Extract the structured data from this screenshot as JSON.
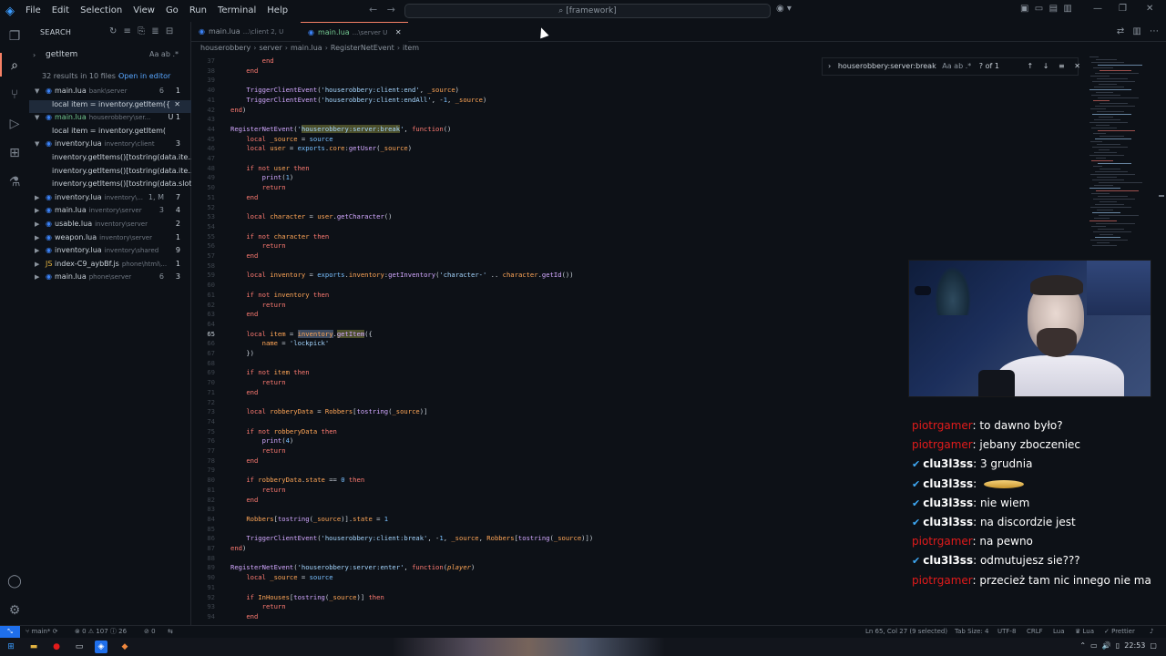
{
  "menu": [
    "File",
    "Edit",
    "Selection",
    "View",
    "Go",
    "Run",
    "Terminal",
    "Help"
  ],
  "command_center": "[framework]",
  "sidebar": {
    "title": "SEARCH",
    "query": "getItem",
    "toggles": "Aa ab .*",
    "summary": "32 results in 10 files - ",
    "open_in_editor": "Open in editor",
    "files": [
      {
        "name": "main.lua",
        "path": "bank\\server",
        "count": "6",
        "badge": "1",
        "expanded": true,
        "git": false,
        "matches": [
          {
            "text": "local item = inventory.getItem({",
            "selected": true
          }
        ]
      },
      {
        "name": "main.lua",
        "path": "houserobbery\\ser...",
        "count": "",
        "badge": "U  1",
        "expanded": true,
        "git": true,
        "matches": [
          {
            "text": "local item = inventory.getItem(",
            "selected": false
          }
        ]
      },
      {
        "name": "inventory.lua",
        "path": "inventory\\client",
        "count": "",
        "badge": "3",
        "expanded": true,
        "git": false,
        "matches": [
          {
            "text": "inventory.getItems()[tostring(data.ite...",
            "selected": false
          },
          {
            "text": "inventory.getItems()[tostring(data.ite...",
            "selected": false
          },
          {
            "text": "inventory.getItems()[tostring(data.slot...",
            "selected": false
          }
        ]
      },
      {
        "name": "inventory.lua",
        "path": "inventory\\...",
        "count": "1, M",
        "badge": "7",
        "expanded": false,
        "git": false,
        "matches": []
      },
      {
        "name": "main.lua",
        "path": "inventory\\server",
        "count": "3",
        "badge": "4",
        "expanded": false,
        "git": false,
        "matches": []
      },
      {
        "name": "usable.lua",
        "path": "inventory\\server",
        "count": "",
        "badge": "2",
        "expanded": false,
        "git": false,
        "matches": []
      },
      {
        "name": "weapon.lua",
        "path": "inventory\\server",
        "count": "",
        "badge": "1",
        "expanded": false,
        "git": false,
        "matches": []
      },
      {
        "name": "inventory.lua",
        "path": "inventory\\shared",
        "count": "",
        "badge": "9",
        "expanded": false,
        "git": false,
        "matches": []
      },
      {
        "name": "index-C9_aybBf.js",
        "path": "phone\\html\\...",
        "count": "",
        "badge": "1",
        "expanded": false,
        "git": false,
        "matches": []
      },
      {
        "name": "main.lua",
        "path": "phone\\server",
        "count": "6",
        "badge": "3",
        "expanded": false,
        "git": false,
        "matches": []
      }
    ]
  },
  "tabs": [
    {
      "label": "main.lua",
      "desc": "...\\client 2, U",
      "active": false
    },
    {
      "label": "main.lua",
      "desc": "...\\server U",
      "active": true
    }
  ],
  "breadcrumb": [
    "houserobbery",
    "server",
    "main.lua",
    "RegisterNetEvent",
    "item"
  ],
  "find_widget": {
    "query": "houserobbery:server:break",
    "toggles": "Aa ab .*",
    "count": "? of 1"
  },
  "code_lines": [
    {
      "n": "37",
      "html": "<span class=\"kw\">        end</span>"
    },
    {
      "n": "38",
      "html": "<span class=\"kw\">    end</span>"
    },
    {
      "n": "39",
      "html": ""
    },
    {
      "n": "40",
      "html": "    <span class=\"fn\">TriggerClientEvent</span>(<span class=\"str\">'houserobbery:client:end'</span>, <span class=\"var\">_source</span>)"
    },
    {
      "n": "41",
      "html": "    <span class=\"fn\">TriggerClientEvent</span>(<span class=\"str\">'houserobbery:client:endAll'</span>, -<span class=\"sym\">1</span>, <span class=\"var\">_source</span>)"
    },
    {
      "n": "42",
      "html": "<span class=\"kw\">end</span>)"
    },
    {
      "n": "43",
      "html": ""
    },
    {
      "n": "44",
      "html": "<span class=\"fn\">RegisterNetEvent</span>(<span class=\"str\">'<span class=\"hlw\">houserobbery:server:break</span>'</span>, <span class=\"kw\">function</span>()"
    },
    {
      "n": "45",
      "html": "    <span class=\"kw\">local</span> <span class=\"var\">_source</span> = <span class=\"sym\">source</span>"
    },
    {
      "n": "46",
      "html": "    <span class=\"kw\">local</span> <span class=\"var\">user</span> = <span class=\"sym\">exports</span>.<span class=\"var\">core</span>:<span class=\"fn\">getUser</span>(<span class=\"var\">_source</span>)"
    },
    {
      "n": "47",
      "html": ""
    },
    {
      "n": "48",
      "html": "    <span class=\"kw\">if not</span> <span class=\"var\">user</span> <span class=\"kw\">then</span>"
    },
    {
      "n": "49",
      "html": "        <span class=\"fn\">print</span>(<span class=\"sym\">1</span>)"
    },
    {
      "n": "50",
      "html": "        <span class=\"kw\">return</span>"
    },
    {
      "n": "51",
      "html": "    <span class=\"kw\">end</span>"
    },
    {
      "n": "52",
      "html": ""
    },
    {
      "n": "53",
      "html": "    <span class=\"kw\">local</span> <span class=\"var\">character</span> = <span class=\"var\">user</span>.<span class=\"fn\">getCharacter</span>()"
    },
    {
      "n": "54",
      "html": ""
    },
    {
      "n": "55",
      "html": "    <span class=\"kw\">if not</span> <span class=\"var\">character</span> <span class=\"kw\">then</span>"
    },
    {
      "n": "56",
      "html": "        <span class=\"kw\">return</span>"
    },
    {
      "n": "57",
      "html": "    <span class=\"kw\">end</span>"
    },
    {
      "n": "58",
      "html": ""
    },
    {
      "n": "59",
      "html": "    <span class=\"kw\">local</span> <span class=\"var\">inventory</span> = <span class=\"sym\">exports</span>.<span class=\"var\">inventory</span>:<span class=\"fn\">getInventory</span>(<span class=\"str\">'character-'</span> .. <span class=\"var\">character</span>.<span class=\"fn\">getId</span>())"
    },
    {
      "n": "60",
      "html": ""
    },
    {
      "n": "61",
      "html": "    <span class=\"kw\">if not</span> <span class=\"var\">inventory</span> <span class=\"kw\">then</span>"
    },
    {
      "n": "62",
      "html": "        <span class=\"kw\">return</span>"
    },
    {
      "n": "63",
      "html": "    <span class=\"kw\">end</span>"
    },
    {
      "n": "64",
      "html": ""
    },
    {
      "n": "65",
      "html": "    <span class=\"kw\">local</span> <span class=\"var\">item</span> = <span class=\"var sel\">inventory</span>.<span class=\"fn hlw\">getItem</span>({",
      "cur": true
    },
    {
      "n": "66",
      "html": "        <span class=\"var\">name</span> = <span class=\"str\">'lockpick'</span>"
    },
    {
      "n": "67",
      "html": "    })"
    },
    {
      "n": "68",
      "html": ""
    },
    {
      "n": "69",
      "html": "    <span class=\"kw\">if not</span> <span class=\"var\">item</span> <span class=\"kw\">then</span>"
    },
    {
      "n": "70",
      "html": "        <span class=\"kw\">return</span>"
    },
    {
      "n": "71",
      "html": "    <span class=\"kw\">end</span>"
    },
    {
      "n": "72",
      "html": ""
    },
    {
      "n": "73",
      "html": "    <span class=\"kw\">local</span> <span class=\"var\">robberyData</span> = <span class=\"var\">Robbers</span>[<span class=\"fn\">tostring</span>(<span class=\"var\">_source</span>)]"
    },
    {
      "n": "74",
      "html": ""
    },
    {
      "n": "75",
      "html": "    <span class=\"kw\">if not</span> <span class=\"var\">robberyData</span> <span class=\"kw\">then</span>"
    },
    {
      "n": "76",
      "html": "        <span class=\"fn\">print</span>(<span class=\"sym\">4</span>)"
    },
    {
      "n": "77",
      "html": "        <span class=\"kw\">return</span>"
    },
    {
      "n": "78",
      "html": "    <span class=\"kw\">end</span>"
    },
    {
      "n": "79",
      "html": ""
    },
    {
      "n": "80",
      "html": "    <span class=\"kw\">if</span> <span class=\"var\">robberyData</span>.<span class=\"var\">state</span> == <span class=\"sym\">0</span> <span class=\"kw\">then</span>"
    },
    {
      "n": "81",
      "html": "        <span class=\"kw\">return</span>"
    },
    {
      "n": "82",
      "html": "    <span class=\"kw\">end</span>"
    },
    {
      "n": "83",
      "html": ""
    },
    {
      "n": "84",
      "html": "    <span class=\"var\">Robbers</span>[<span class=\"fn\">tostring</span>(<span class=\"var\">_source</span>)].<span class=\"var\">state</span> = <span class=\"sym\">1</span>"
    },
    {
      "n": "85",
      "html": ""
    },
    {
      "n": "86",
      "html": "    <span class=\"fn\">TriggerClientEvent</span>(<span class=\"str\">'houserobbery:client:break'</span>, -<span class=\"sym\">1</span>, <span class=\"var\">_source</span>, <span class=\"var\">Robbers</span>[<span class=\"fn\">tostring</span>(<span class=\"var\">_source</span>)])"
    },
    {
      "n": "87",
      "html": "<span class=\"kw\">end</span>)"
    },
    {
      "n": "88",
      "html": ""
    },
    {
      "n": "89",
      "html": "<span class=\"fn\">RegisterNetEvent</span>(<span class=\"str\">'houserobbery:server:enter'</span>, <span class=\"kw\">function</span>(<span class=\"prm\">player</span>)"
    },
    {
      "n": "90",
      "html": "    <span class=\"kw\">local</span> <span class=\"var\">_source</span> = <span class=\"sym\">source</span>"
    },
    {
      "n": "91",
      "html": ""
    },
    {
      "n": "92",
      "html": "    <span class=\"kw\">if</span> <span class=\"var\">InHouses</span>[<span class=\"fn\">tostring</span>(<span class=\"var\">_source</span>)] <span class=\"kw\">then</span>"
    },
    {
      "n": "93",
      "html": "        <span class=\"kw\">return</span>"
    },
    {
      "n": "94",
      "html": "    <span class=\"kw\">end</span>"
    }
  ],
  "chat": [
    {
      "user": "piotrgamer",
      "color": "red",
      "badge": false,
      "text": "to dawno było?"
    },
    {
      "user": "piotrgamer",
      "color": "red",
      "badge": false,
      "text": "jebany zboczeniec"
    },
    {
      "user": "clu3l3ss",
      "color": "white",
      "badge": true,
      "text": "3 grudnia"
    },
    {
      "user": "clu3l3ss",
      "color": "white",
      "badge": true,
      "text": "",
      "emote": true
    },
    {
      "user": "clu3l3ss",
      "color": "white",
      "badge": true,
      "text": "nie wiem"
    },
    {
      "user": "clu3l3ss",
      "color": "white",
      "badge": true,
      "text": "na discordzie jest"
    },
    {
      "user": "piotrgamer",
      "color": "red",
      "badge": false,
      "text": "na pewno"
    },
    {
      "user": "clu3l3ss",
      "color": "white",
      "badge": true,
      "text": "odmutujesz sie???"
    },
    {
      "user": "piotrgamer",
      "color": "red",
      "badge": false,
      "text": "przecież tam nic innego nie ma"
    }
  ],
  "statusbar": {
    "branch": "main*",
    "errors": "0",
    "warnings": "107",
    "info": "26",
    "ports": "0",
    "position": "Ln 65, Col 27 (9 selected)",
    "tab_size": "Tab Size: 4",
    "encoding": "UTF-8",
    "eol": "CRLF",
    "language": "Lua",
    "lang_badge": "Lua",
    "prettier": "Prettier"
  },
  "taskbar": {
    "time": "22:53"
  }
}
